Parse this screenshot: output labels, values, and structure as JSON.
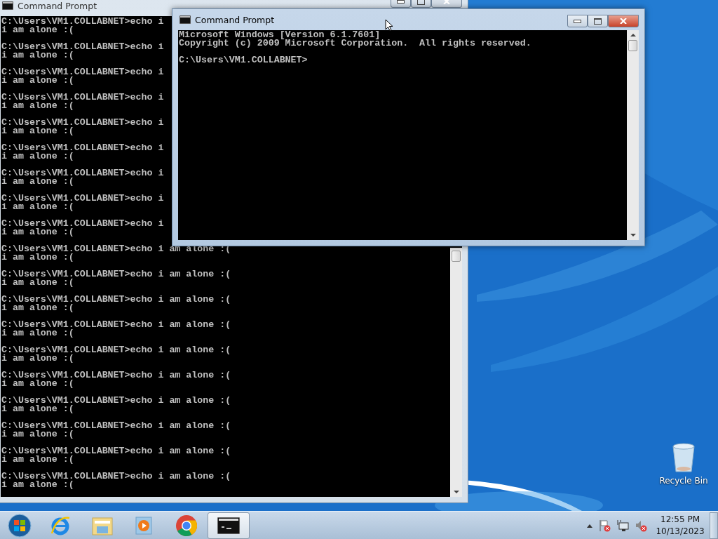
{
  "desktop": {
    "icons": [
      {
        "label": "Recycle Bin"
      }
    ]
  },
  "windows": [
    {
      "title": "Command Prompt",
      "active": false,
      "blocks": [
        {
          "lines": [
            "C:\\Users\\VM1.COLLABNET>echo i",
            "i am alone :("
          ]
        },
        {
          "lines": [
            "C:\\Users\\VM1.COLLABNET>echo i",
            "i am alone :("
          ]
        },
        {
          "lines": [
            "C:\\Users\\VM1.COLLABNET>echo i",
            "i am alone :("
          ]
        },
        {
          "lines": [
            "C:\\Users\\VM1.COLLABNET>echo i",
            "i am alone :("
          ]
        },
        {
          "lines": [
            "C:\\Users\\VM1.COLLABNET>echo i",
            "i am alone :("
          ]
        },
        {
          "lines": [
            "C:\\Users\\VM1.COLLABNET>echo i",
            "i am alone :("
          ]
        },
        {
          "lines": [
            "C:\\Users\\VM1.COLLABNET>echo i",
            "i am alone :("
          ]
        },
        {
          "lines": [
            "C:\\Users\\VM1.COLLABNET>echo i",
            "i am alone :("
          ]
        },
        {
          "lines": [
            "C:\\Users\\VM1.COLLABNET>echo i",
            "i am alone :("
          ]
        },
        {
          "lines": [
            "C:\\Users\\VM1.COLLABNET>echo i am alone :(",
            "i am alone :("
          ]
        },
        {
          "lines": [
            "C:\\Users\\VM1.COLLABNET>echo i am alone :(",
            "i am alone :("
          ]
        },
        {
          "lines": [
            "C:\\Users\\VM1.COLLABNET>echo i am alone :(",
            "i am alone :("
          ]
        },
        {
          "lines": [
            "C:\\Users\\VM1.COLLABNET>echo i am alone :(",
            "i am alone :("
          ]
        },
        {
          "lines": [
            "C:\\Users\\VM1.COLLABNET>echo i am alone :(",
            "i am alone :("
          ]
        },
        {
          "lines": [
            "C:\\Users\\VM1.COLLABNET>echo i am alone :(",
            "i am alone :("
          ]
        },
        {
          "lines": [
            "C:\\Users\\VM1.COLLABNET>echo i am alone :(",
            "i am alone :("
          ]
        },
        {
          "lines": [
            "C:\\Users\\VM1.COLLABNET>echo i am alone :(",
            "i am alone :("
          ]
        },
        {
          "lines": [
            "C:\\Users\\VM1.COLLABNET>echo i am alone :(",
            "i am alone :("
          ]
        },
        {
          "lines": [
            "C:\\Users\\VM1.COLLABNET>echo i am alone :(",
            "i am alone :("
          ]
        }
      ]
    },
    {
      "title": "Command Prompt",
      "active": true,
      "blocks": [
        {
          "lines": [
            "Microsoft Windows [Version 6.1.7601]",
            "Copyright (c) 2009 Microsoft Corporation.  All rights reserved."
          ]
        },
        {
          "lines": [
            "C:\\Users\\VM1.COLLABNET>"
          ]
        }
      ]
    }
  ],
  "taskbar": {
    "items": [
      {
        "kind": "start",
        "selected": false
      },
      {
        "kind": "browser-e",
        "selected": false
      },
      {
        "kind": "folder",
        "selected": false
      },
      {
        "kind": "media",
        "selected": false
      },
      {
        "kind": "chrome",
        "selected": false
      },
      {
        "kind": "console",
        "selected": true
      }
    ],
    "tray": [
      {
        "kind": "arrow"
      },
      {
        "kind": "flag"
      },
      {
        "kind": "network"
      },
      {
        "kind": "speaker"
      }
    ],
    "clock": {
      "time": "12:55 PM",
      "date": "10/13/2023"
    }
  }
}
